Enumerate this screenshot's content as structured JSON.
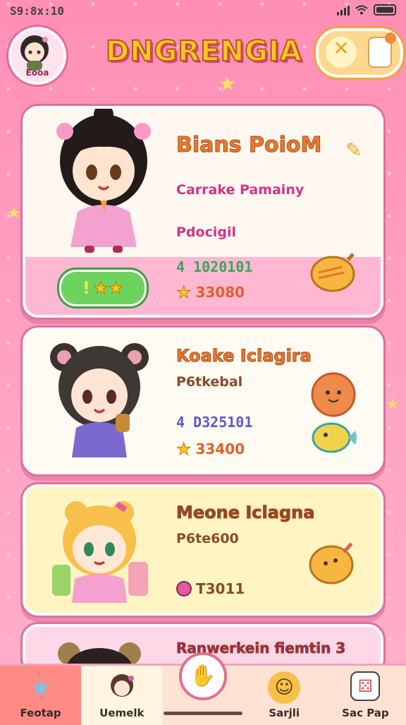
{
  "status_bar": {
    "time": "S9:8x:10"
  },
  "header": {
    "avatar_label": "Eooa",
    "title": "DNGRENGIA",
    "toggle_icon": "x-icon"
  },
  "cards": [
    {
      "name": "Bians PoioM",
      "subtitle": "Carrake Pamainy",
      "type": "Pdocigil",
      "code": "4 1020101",
      "stars": "33080",
      "badge": "!",
      "accent": "#ffb7d2"
    },
    {
      "name": "Koake Iclagira",
      "type": "P6tkebal",
      "code": "4 D325101",
      "stars": "33400"
    },
    {
      "name": "Meone Iclagna",
      "type": "P6te600",
      "code": "",
      "stars": "T3011"
    },
    {
      "name": "Ranwerkein fiemtin 3"
    }
  ],
  "bottom_nav": [
    {
      "label": "Feotap",
      "icon": "star-icon"
    },
    {
      "label": "Uemelk",
      "icon": "avatar-icon"
    },
    {
      "label": "",
      "icon": "hand-icon"
    },
    {
      "label": "Sarjli",
      "icon": "smile-icon"
    },
    {
      "label": "Sac Pap",
      "icon": "dice-icon"
    }
  ],
  "colors": {
    "primary_pink": "#ff8fb4",
    "accent_gold": "#ffc529",
    "green": "#6cd35f"
  }
}
